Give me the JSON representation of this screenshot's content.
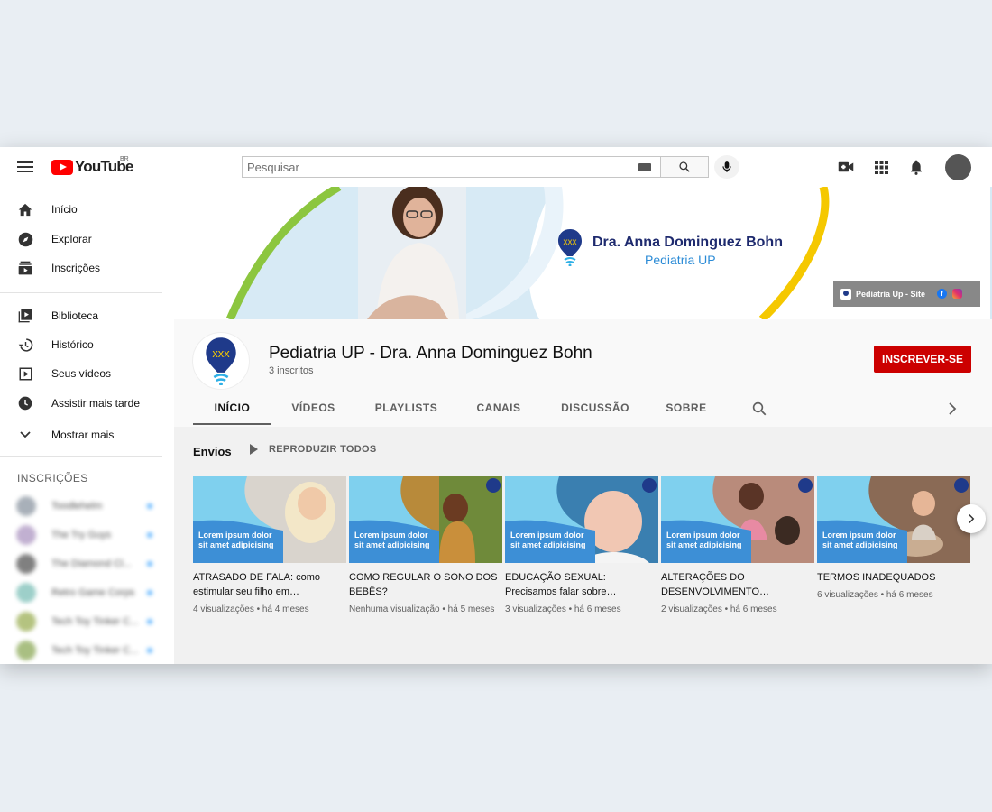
{
  "header": {
    "logo_text": "YouTube",
    "region": "BR",
    "search_placeholder": "Pesquisar",
    "icons": [
      "menu-icon",
      "keyboard-icon",
      "search-icon",
      "mic-icon",
      "create-video-icon",
      "apps-icon",
      "notifications-icon"
    ]
  },
  "sidebar": {
    "main": [
      {
        "label": "Início",
        "icon": "home-icon"
      },
      {
        "label": "Explorar",
        "icon": "compass-icon"
      },
      {
        "label": "Inscrições",
        "icon": "subscriptions-icon"
      }
    ],
    "library": [
      {
        "label": "Biblioteca",
        "icon": "library-icon"
      },
      {
        "label": "Histórico",
        "icon": "history-icon"
      },
      {
        "label": "Seus vídeos",
        "icon": "your-videos-icon"
      },
      {
        "label": "Assistir mais tarde",
        "icon": "watch-later-icon"
      },
      {
        "label": "Mostrar mais",
        "icon": "chevron-down-icon"
      }
    ],
    "subscriptions_heading": "INSCRIÇÕES",
    "subscriptions": [
      {
        "name": "Toodlehelm",
        "color": "#9aa3ad"
      },
      {
        "name": "The Try Guys",
        "color": "#b7a3c9"
      },
      {
        "name": "The Diamond Cl...",
        "color": "#6b6b6b"
      },
      {
        "name": "Retro Game Corps",
        "color": "#8cc7c0"
      },
      {
        "name": "Tech Toy Tinker C...",
        "color": "#a8b96a"
      },
      {
        "name": "Tech Toy Tinker C...",
        "color": "#9bb46d"
      }
    ]
  },
  "banner": {
    "brand_title": "Dra. Anna Dominguez Bohn",
    "brand_subtitle": "Pediatria UP",
    "site_link": "Pediatria Up - Site",
    "colors": {
      "green": "#8cc63f",
      "yellow": "#f5c800",
      "light_blue": "#cfe6f3"
    }
  },
  "channel": {
    "name": "Pediatria UP - Dra. Anna Dominguez Bohn",
    "subscribers": "3 inscritos",
    "subscribe_label": "INSCREVER-SE",
    "tabs": [
      "INÍCIO",
      "VÍDEOS",
      "PLAYLISTS",
      "CANAIS",
      "DISCUSSÃO",
      "SOBRE"
    ],
    "active_tab": "INÍCIO"
  },
  "uploads": {
    "section_title": "Envios",
    "play_all": "REPRODUZIR TODOS",
    "videos": [
      {
        "thumb_text": "Lorem ipsum dolor sit amet adipicising",
        "title": "ATRASADO DE FALA: como estimular seu filho em…",
        "meta": "4 visualizações • há 4 meses",
        "photo_color": "#d9d4cd"
      },
      {
        "thumb_text": "Lorem ipsum dolor sit amet adipicising",
        "title": "COMO REGULAR O SONO DOS BEBÊS?",
        "meta": "Nenhuma visualização • há 5 meses",
        "photo_color": "#b88a3a"
      },
      {
        "thumb_text": "Lorem ipsum dolor sit amet adipicising",
        "title": "EDUCAÇÃO SEXUAL: Precisamos falar sobre…",
        "meta": "3 visualizações • há 6 meses",
        "photo_color": "#3a7fb0"
      },
      {
        "thumb_text": "Lorem ipsum dolor sit amet adipicising",
        "title": "ALTERAÇÕES DO DESENVOLVIMENTO…",
        "meta": "2 visualizações • há 6 meses",
        "photo_color": "#b98b7b"
      },
      {
        "thumb_text": "Lorem ipsum dolor sit amet adipicising",
        "title": "TERMOS INADEQUADOS",
        "meta": "6 visualizações • há 6 meses",
        "photo_color": "#8a6a55"
      }
    ]
  },
  "colors": {
    "accent_red": "#cc0000",
    "thumb_blue": "#3d8fd6",
    "thumb_light": "#7fd0ee"
  }
}
